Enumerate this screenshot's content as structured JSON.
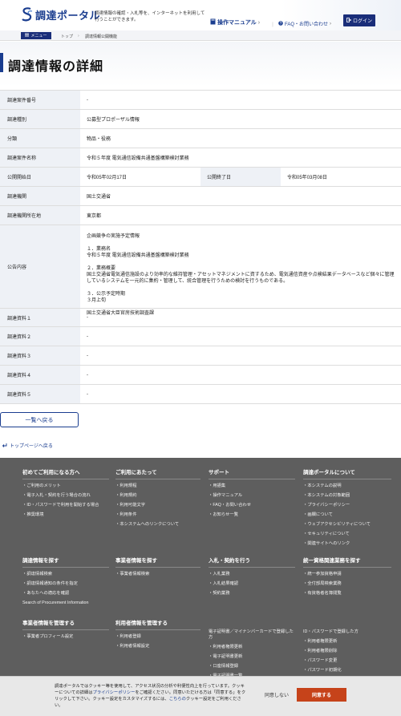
{
  "header": {
    "logo_text": "調達ポータル",
    "tagline": "調達情報の確認・入札等を、インターネットを利用して行うことができます。",
    "manual_label": "操作マニュアル",
    "manual_arrow": "›",
    "sep1": "｜",
    "faq_label": "FAQ・お問い合わせ",
    "faq_arrow": "›",
    "login_label": "ログイン"
  },
  "breadcrumb": {
    "menu_label": "メニュー",
    "items": [
      "トップ",
      "調達情報公開機能"
    ],
    "separator": "›"
  },
  "page_title": "調達情報の詳細",
  "details": {
    "case_no": {
      "label": "調達案件番号",
      "value": "-"
    },
    "type": {
      "label": "調達種別",
      "value": "公募型プロポーザル情報"
    },
    "category": {
      "label": "分類",
      "value": "物品・役務"
    },
    "name": {
      "label": "調達案件名称",
      "value": "令和５年度 電気通信設備共通基盤構築検討業務"
    },
    "start": {
      "label": "公開開始日",
      "value": "令和05年02月17日"
    },
    "end": {
      "label": "公開終了日",
      "value": "令和05年03月08日"
    },
    "org": {
      "label": "調達機関",
      "value": "国土交通省"
    },
    "location": {
      "label": "調達機関所在地",
      "value": "東京都"
    },
    "public": {
      "label": "公告内容",
      "lines": [
        "企画競争の実施予定情報",
        "１．業務名",
        "令和５年度 電気通信設備共通基盤構築検討業務",
        "２．業務概要",
        "国土交通省電気通信施設のより効率的な維持管理・アセットマネジメントに資するため、電気通信資産や点検結果データベースなど個々に管理しているシステムを一元的に集約・管理して、統合管理を行うための検討を行うものである。",
        "３．公示予定時期",
        "３月上旬",
        "国土交通省大臣官房技術調査課"
      ]
    },
    "docs": [
      {
        "label": "調達資料１",
        "value": "-"
      },
      {
        "label": "調達資料２",
        "value": "-"
      },
      {
        "label": "調達資料３",
        "value": "-"
      },
      {
        "label": "調達資料４",
        "value": "-"
      },
      {
        "label": "調達資料５",
        "value": "-"
      }
    ]
  },
  "back_to_list": "一覧へ戻る",
  "back_to_top": "トップページへ戻る",
  "footer": {
    "col1": {
      "title": "初めてご利用になる方へ",
      "items": [
        "ご利用のメリット",
        "電子入札・契約を行う場合の流れ",
        "ID・パスワードで利用を開始する場合",
        "推奨環境"
      ]
    },
    "col2": {
      "title": "ご利用にあたって",
      "items": [
        "利用規程",
        "利用規約",
        "利用可能文字",
        "利用条件",
        "本システムへのリンクについて"
      ]
    },
    "col3": {
      "title": "サポート",
      "items": [
        "用語集",
        "操作マニュアル",
        "FAQ・お問い合わせ",
        "お知らせ一覧"
      ]
    },
    "col4": {
      "title": "調達ポータルについて",
      "items": [
        "本システムの説明",
        "本システムの対象範囲",
        "プライバシーポリシー",
        "画欄について",
        "ウェブアクセシビリティについて",
        "セキュリティについて",
        "関連サイトへのリンク"
      ]
    },
    "col5": {
      "title": "調達情報を探す",
      "items": [
        "調達情報検索",
        "調達情報通知の条件を指定",
        "あなたへの適応を確認",
        "Search of Procurement Information"
      ]
    },
    "col6": {
      "title": "事業者情報を探す",
      "items": [
        "事業者情報検索"
      ]
    },
    "col7": {
      "title": "入札・契約を行う",
      "items": [
        "入札業務",
        "入札結果確認",
        "契約業務"
      ]
    },
    "col8": {
      "title": "統一資格関連業務を探す",
      "items": [
        "統一参加資格申請",
        "全付部局検索業務",
        "有資格者名簿閲覧"
      ]
    },
    "col9": {
      "title": "事業者情報を管理する",
      "items": [
        "事業者プロフィール設定"
      ]
    },
    "col10": {
      "title": "利用者情報を管理する",
      "items": [
        "利用者登録",
        "利用者情報設定"
      ]
    },
    "col11": {
      "title": "電子証明書／マイナンバーカードで登録した方",
      "items": [
        "利用者権限更新",
        "電子証明書更新",
        "口座情報登録",
        "電子証明書一覧"
      ]
    },
    "col12": {
      "title": "ID・パスワードで登録した方",
      "items": [
        "利用者権限更新",
        "利用者権限削除",
        "パスワード変更",
        "パスワード初期化"
      ]
    }
  },
  "cookie": {
    "text_before": "調達ポータルではクッキー等を使用して、アクセス状況の分析や利便性向上を行っています。クッキーについての詳細は",
    "policy_link": "プライバシーポリシー",
    "text_middle": "をご確認ください。同意いただける方は「同意する」をクリックして下さい。クッキー設定をカスタマイズするには、",
    "here_link": "こちらの",
    "text_after": "クッキー設定をご利用ください。",
    "decline_label": "同意しない",
    "agree_label": "同意する"
  },
  "colors": {
    "brand": "#1a3d8f",
    "accent": "#c6431a",
    "footer_bg": "#5e5e5e"
  }
}
